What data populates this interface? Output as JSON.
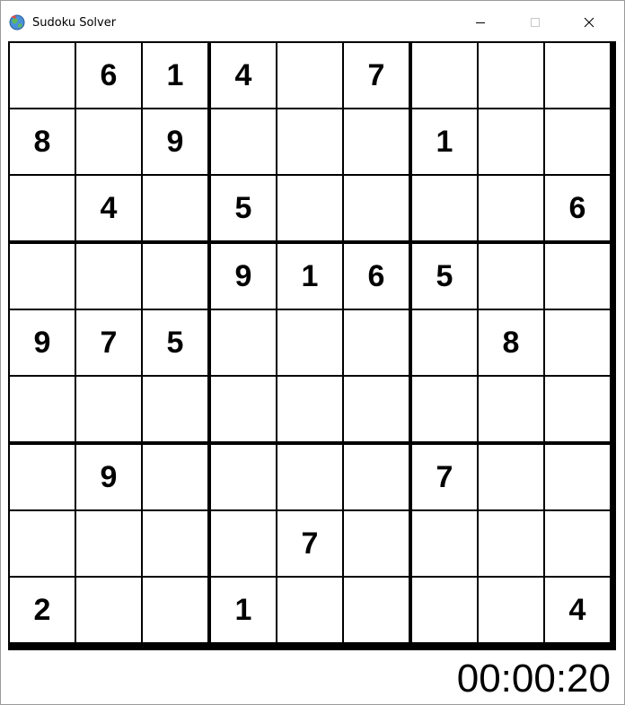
{
  "window": {
    "title": "Sudoku Solver",
    "app_icon": "sudoku-app-icon",
    "controls": {
      "minimize_icon": "minimize-icon",
      "maximize_icon": "maximize-icon",
      "close_icon": "close-icon"
    }
  },
  "board": {
    "size": 9,
    "rows": [
      [
        "",
        "6",
        "1",
        "4",
        "",
        "7",
        "",
        "",
        ""
      ],
      [
        "8",
        "",
        "9",
        "",
        "",
        "",
        "1",
        "",
        ""
      ],
      [
        "",
        "4",
        "",
        "5",
        "",
        "",
        "",
        "",
        "6"
      ],
      [
        "",
        "",
        "",
        "9",
        "1",
        "6",
        "5",
        "",
        ""
      ],
      [
        "9",
        "7",
        "5",
        "",
        "",
        "",
        "",
        "8",
        ""
      ],
      [
        "",
        "",
        "",
        "",
        "",
        "",
        "",
        "",
        ""
      ],
      [
        "",
        "9",
        "",
        "",
        "",
        "",
        "7",
        "",
        ""
      ],
      [
        "",
        "",
        "",
        "",
        "7",
        "",
        "",
        "",
        ""
      ],
      [
        "2",
        "",
        "",
        "1",
        "",
        "",
        "",
        "",
        "4"
      ]
    ]
  },
  "status": {
    "timer": "00:00:20"
  },
  "colors": {
    "grid_line": "#000000",
    "cell_background": "#ffffff",
    "digit": "#000000",
    "window_border": "#9a9a9a"
  }
}
